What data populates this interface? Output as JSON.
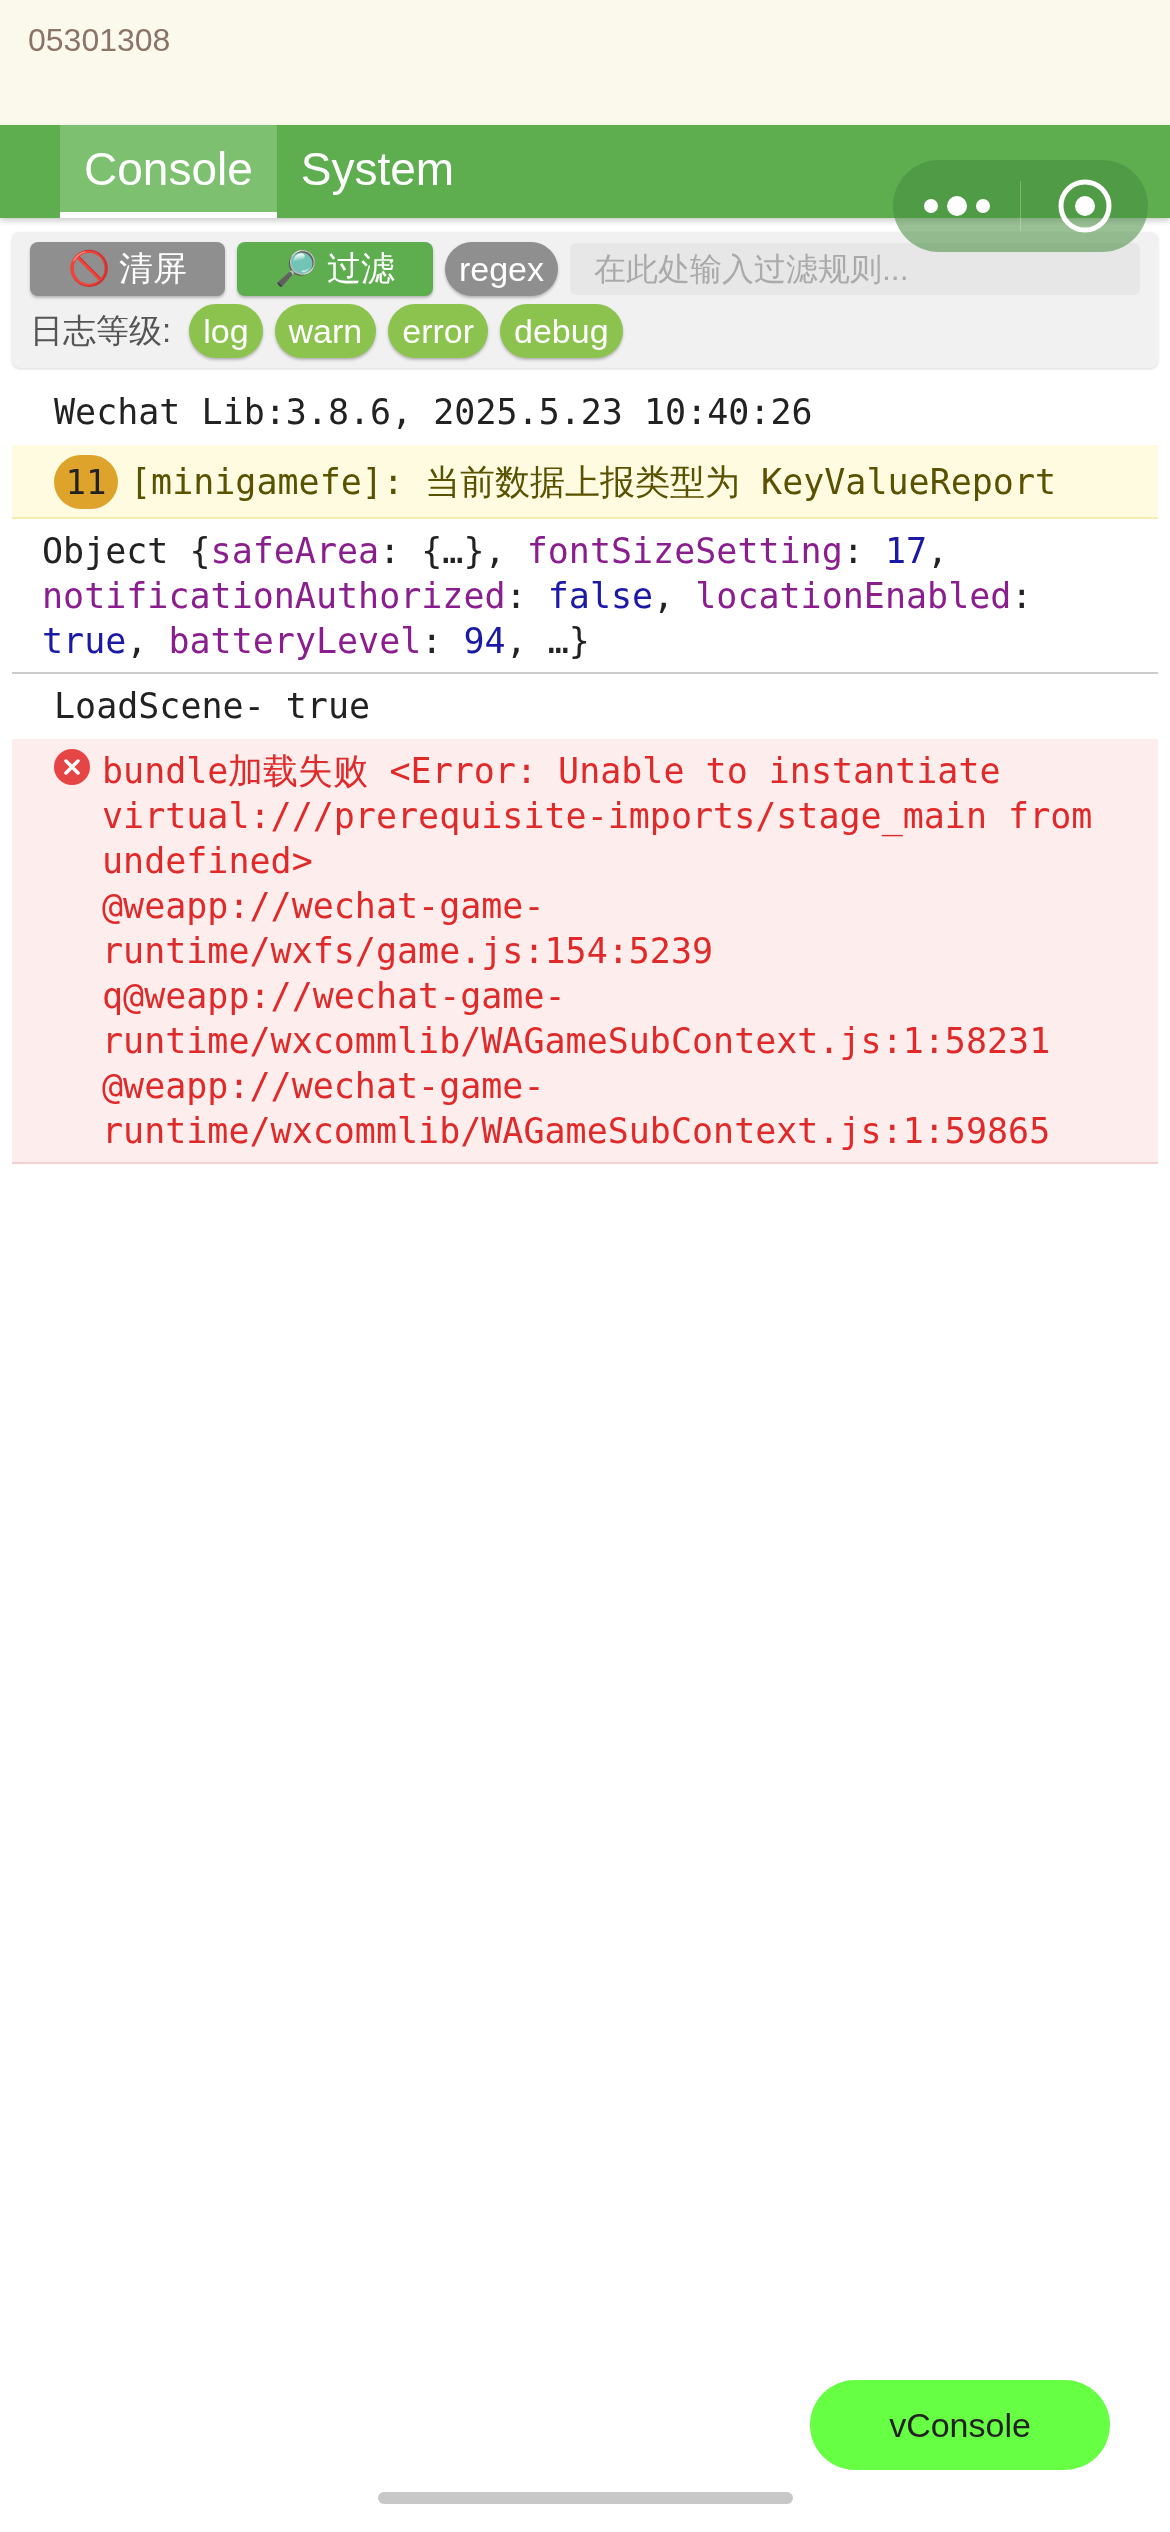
{
  "header": {
    "label": "05301308"
  },
  "tabs": [
    {
      "label": "Console",
      "selected": true
    },
    {
      "label": "System",
      "selected": false
    }
  ],
  "toolbar": {
    "clear_button": "🚫 清屏",
    "filter_button": "🔎 过滤",
    "regex_button": "regex",
    "filter_field": {
      "placeholder": "在此处输入过滤规则..."
    }
  },
  "levels": {
    "label": "日志等级:",
    "buttons": [
      "log",
      "warn",
      "error",
      "debug"
    ]
  },
  "logs": [
    {
      "kind": "log",
      "text": "Wechat Lib:3.8.6, 2025.5.23 10:40:26"
    },
    {
      "kind": "warn",
      "count": "11",
      "text": "[minigamefe]: 当前数据上报类型为 KeyValueReport"
    },
    {
      "kind": "object",
      "segments": [
        {
          "kind": "plain",
          "text": "Object {"
        },
        {
          "kind": "key",
          "text": "safeArea"
        },
        {
          "kind": "plain",
          "text": ": {…}, "
        },
        {
          "kind": "key",
          "text": "fontSizeSetting"
        },
        {
          "kind": "plain",
          "text": ": "
        },
        {
          "kind": "number",
          "text": "17"
        },
        {
          "kind": "plain",
          "text": ", "
        },
        {
          "kind": "key",
          "text": "notificationAuthorized"
        },
        {
          "kind": "plain",
          "text": ": "
        },
        {
          "kind": "bool",
          "text": "false"
        },
        {
          "kind": "plain",
          "text": ", "
        },
        {
          "kind": "key",
          "text": "locationEnabled"
        },
        {
          "kind": "plain",
          "text": ": "
        },
        {
          "kind": "bool",
          "text": "true"
        },
        {
          "kind": "plain",
          "text": ", "
        },
        {
          "kind": "key",
          "text": "batteryLevel"
        },
        {
          "kind": "plain",
          "text": ": "
        },
        {
          "kind": "number",
          "text": "94"
        },
        {
          "kind": "plain",
          "text": ", …}"
        }
      ]
    },
    {
      "kind": "log",
      "text": "LoadScene- true"
    },
    {
      "kind": "error",
      "lines": [
        "bundle加载失败 <Error: Unable to instantiate",
        "virtual:///prerequisite-imports/stage_main from",
        "undefined>",
        "@weapp://wechat-game-",
        "runtime/wxfs/game.js:154:5239",
        "q@weapp://wechat-game-",
        "runtime/wxcommlib/WAGameSubContext.js:1:58231",
        "@weapp://wechat-game-",
        "runtime/wxcommlib/WAGameSubContext.js:1:59865"
      ]
    }
  ],
  "vconsole_button": "vConsole"
}
